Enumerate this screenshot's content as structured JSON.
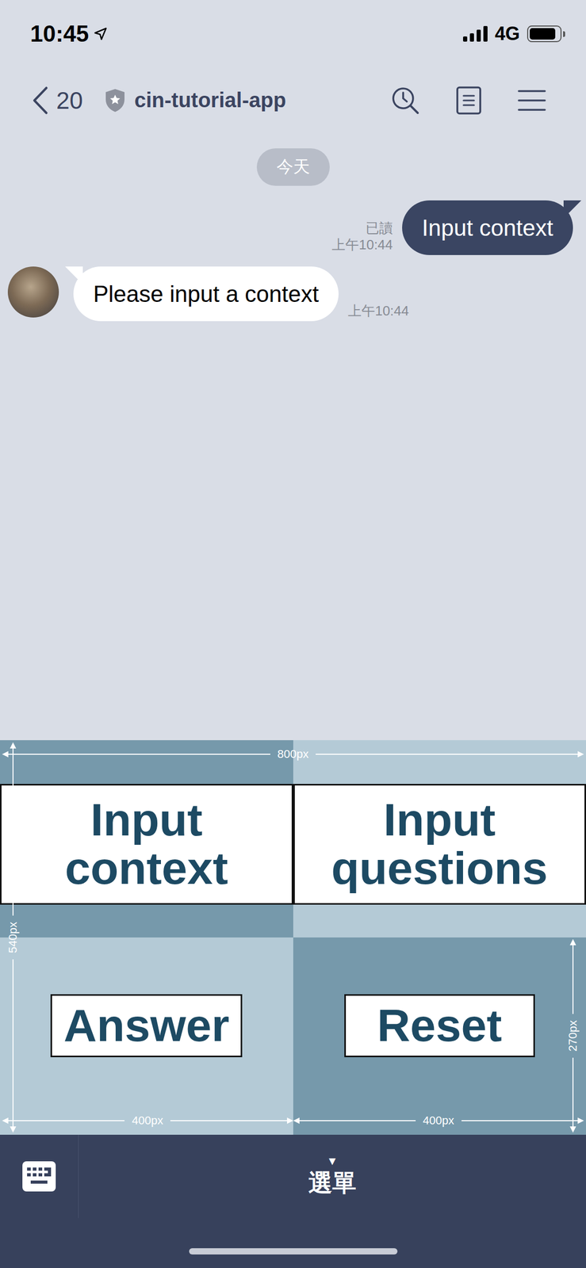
{
  "status_bar": {
    "time": "10:45",
    "signal_level": 4,
    "network": "4G",
    "battery_level": 0.88
  },
  "header": {
    "back_count": "20",
    "title": "cin-tutorial-app"
  },
  "date_divider": "今天",
  "messages": [
    {
      "direction": "outgoing",
      "text": "Input context",
      "read_receipt": "已讀",
      "time": "上午10:44"
    },
    {
      "direction": "incoming",
      "text": "Please input a context",
      "time": "上午10:44"
    }
  ],
  "rich_menu": {
    "buttons": [
      {
        "label": "Input context",
        "color": "#7699ab"
      },
      {
        "label": "Input questions",
        "color": "#b4cad6"
      },
      {
        "label": "Answer",
        "color": "#b4cad6"
      },
      {
        "label": "Reset",
        "color": "#7699ab"
      }
    ],
    "dimensions": {
      "total_width": "800px",
      "total_height": "540px",
      "column_widths": [
        "400px",
        "400px"
      ],
      "row_height": "270px"
    }
  },
  "bottom_bar": {
    "menu_arrow": "▼",
    "menu_label": "選單"
  }
}
